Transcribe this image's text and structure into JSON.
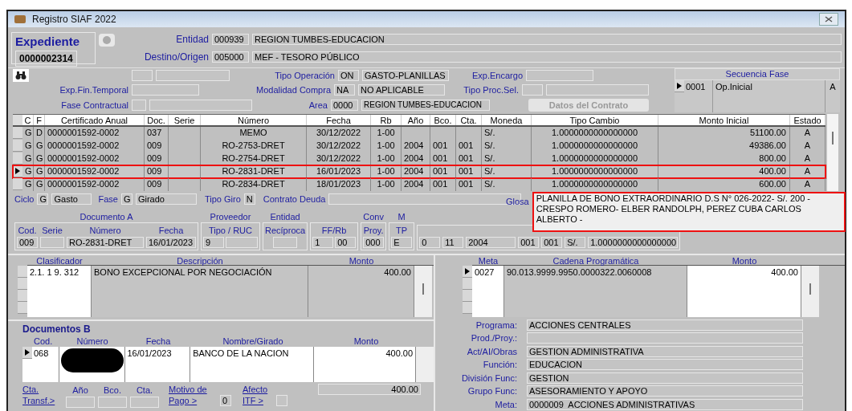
{
  "window": {
    "title": "Registro SIAF 2022"
  },
  "expediente": {
    "label": "Expediente",
    "number": "0000002314"
  },
  "entidad": {
    "label": "Entidad",
    "code": "000939",
    "name": "REGION TUMBES-EDUCACION"
  },
  "destino": {
    "label": "Destino/Origen",
    "code": "005000",
    "name": "MEF - TESORO PÚBLICO"
  },
  "left_fields": [
    {
      "label": "Exp.Fin.Temporal"
    },
    {
      "label": "Fase Contractual"
    }
  ],
  "mid_fields": [
    {
      "label": "Tipo Operación",
      "code": "ON",
      "name": "GASTO-PLANILLAS"
    },
    {
      "label": "Modalidad Compra",
      "code": "NA",
      "name": "NO APLICABLE"
    },
    {
      "label": "Area",
      "code": "0000",
      "name": "REGION TUMBES-EDUCACION"
    }
  ],
  "right_fields": [
    {
      "label": "Exp.Encargo"
    },
    {
      "label": "Tipo Proc.Sel."
    }
  ],
  "contract_button": {
    "label": "Datos del Contrato",
    "disabled": true
  },
  "secuencia_fase": {
    "title": "Secuencia Fase",
    "rows": [
      {
        "code": "0001",
        "name": "Op.Inicial",
        "estado": "A",
        "selected": true
      }
    ]
  },
  "registros": {
    "columns": [
      "C",
      "F",
      "Certificado Anual",
      "Doc.",
      "Serie",
      "Número",
      "Fecha",
      "Rb",
      "Año",
      "Bco.",
      "Cta.",
      "Moneda",
      "Tipo Cambio",
      "Monto Inicial",
      "Estado"
    ],
    "rows": [
      {
        "selected": false,
        "annotated": false,
        "cells": [
          "G",
          "D",
          "0000001592-0002",
          "037",
          null,
          "MEMO",
          "30/12/2022",
          "1-00",
          null,
          null,
          null,
          "S/.",
          "1.0000000000000000",
          "51100.00",
          "A"
        ]
      },
      {
        "selected": false,
        "annotated": false,
        "cells": [
          "G",
          "G",
          "0000001592-0002",
          "009",
          null,
          "RO-2753-DRET",
          "30/12/2022",
          "1-00",
          "2004",
          "001",
          "001",
          "S/.",
          "1.0000000000000000",
          "49386.00",
          "A"
        ]
      },
      {
        "selected": false,
        "annotated": false,
        "cells": [
          "G",
          "G",
          "0000001592-0002",
          "009",
          null,
          "RO-2754-DRET",
          "30/12/2022",
          "1-00",
          "2004",
          "001",
          "001",
          "S/.",
          "1.0000000000000000",
          "800.00",
          "A"
        ]
      },
      {
        "selected": true,
        "annotated": true,
        "cells": [
          "G",
          "G",
          "0000001592-0002",
          "009",
          null,
          "RO-2831-DRET",
          "16/01/2023",
          "1-00",
          "2004",
          "001",
          "001",
          "S/.",
          "1.0000000000000000",
          "400.00",
          "A"
        ]
      },
      {
        "selected": false,
        "annotated": false,
        "cells": [
          "G",
          "G",
          "0000001592-0002",
          "009",
          null,
          "RO-2834-DRET",
          "18/01/2023",
          "1-00",
          "2004",
          "001",
          "001",
          "S/.",
          "1.0000000000000000",
          "600.00",
          "A"
        ]
      }
    ]
  },
  "ciclo": {
    "label": "Ciclo",
    "code": "G",
    "name": "Gasto"
  },
  "fase": {
    "label": "Fase",
    "code": "G",
    "name": "Girado"
  },
  "tipo_giro": {
    "label": "Tipo Giro",
    "code": "N"
  },
  "contrato_deuda": {
    "label": "Contrato Deuda"
  },
  "glosa": {
    "label": "Glosa",
    "annotated": true,
    "text": "PLANILLA DE BONO EXTRAORDINARIO D.S N° 026-2022- S/. 200 - CRESPO ROMERO- ELBER RANDOLPH, PEREZ CUBA CARLOS ALBERTO -"
  },
  "documento_groups": [
    {
      "title": "Documento A",
      "fields": [
        {
          "label": "Cod.",
          "boxes": [
            {
              "value": "009"
            }
          ]
        },
        {
          "label": "Serie",
          "blank": true
        },
        {
          "label": "Número",
          "boxes": [
            {
              "value": "RO-2831-DRET"
            }
          ]
        },
        {
          "label": "Fecha",
          "boxes": [
            {
              "value": "16/01/2023"
            }
          ]
        }
      ]
    },
    {
      "title": "Proveedor",
      "fields": [
        {
          "label": "Tipo / RUC",
          "boxes": [
            {
              "value": "9"
            }
          ],
          "blank": true
        }
      ]
    },
    {
      "title": "Entidad",
      "fields": [
        {
          "label": "Recíproca",
          "blank": true
        }
      ]
    },
    {
      "fields": [
        {
          "label": "FF/Rb",
          "boxes": [
            {
              "value": "1"
            },
            {
              "value": "00"
            }
          ]
        }
      ]
    },
    {
      "title": "Conv",
      "fields": [
        {
          "label": "Proy.",
          "boxes": [
            {
              "value": "000"
            }
          ]
        }
      ]
    },
    {
      "title": "M",
      "fields": [
        {
          "label": "TP",
          "boxes": [
            {
              "value": "E"
            }
          ]
        }
      ]
    },
    {
      "fields": [
        {
          "boxes": [
            {
              "value": "0"
            }
          ]
        },
        {
          "boxes": [
            {
              "value": "11"
            }
          ]
        },
        {
          "boxes": [
            {
              "value": "2004"
            }
          ]
        },
        {
          "boxes": [
            {
              "value": "001"
            }
          ]
        },
        {
          "boxes": [
            {
              "value": "001"
            }
          ]
        },
        {
          "boxes": [
            {
              "value": "S/."
            }
          ]
        },
        {
          "boxes": [
            {
              "value": "1.0000000000000000"
            }
          ]
        }
      ]
    }
  ],
  "clasificador": {
    "columns": [
      "Clasificador",
      "Descripción",
      "Monto"
    ],
    "rows": [
      {
        "selected": false,
        "cells": [
          "2.1. 1 9. 312",
          "BONO EXCEPCIONAL POR NEGOCIACIÓN",
          "400.00"
        ]
      }
    ]
  },
  "metas": {
    "columns": [
      "Meta",
      "Cadena Programática",
      "Monto"
    ],
    "rows": [
      {
        "selected": true,
        "cells": [
          "0027",
          "90.013.9999.9950.0000322.0060008",
          "400.00"
        ]
      }
    ]
  },
  "documentos_b": {
    "title": "Documentos B",
    "columns": [
      "Cod.",
      "Número",
      "Fecha",
      "Nombre/Girado",
      "Monto"
    ],
    "rows": [
      {
        "selected": true,
        "redacted": true,
        "cells": [
          "068",
          null,
          "16/01/2023",
          "BANCO DE LA NACION",
          "400.00"
        ]
      }
    ],
    "total": "400.00"
  },
  "bottom_links": {
    "cta": "Cta. Transf.>",
    "labels": [
      "Año",
      "Bco.",
      "Cta."
    ],
    "motivo": "Motivo de Pago >",
    "motivo_value": "0",
    "afecto": "Afecto ITF >"
  },
  "programa": [
    {
      "label": "Programa:",
      "value": "ACCIONES CENTRALES"
    },
    {
      "label": "Prod./Proy.:"
    },
    {
      "label": "Act/AI/Obras",
      "value": "GESTION ADMINISTRATIVA"
    },
    {
      "label": "Función:",
      "value": "EDUCACION"
    },
    {
      "label": "División Func:",
      "value": "GESTION"
    },
    {
      "label": "Grupo Func:",
      "value": "ASESORAMIENTO Y APOYO"
    },
    {
      "label": "Meta:",
      "value": "0000009  ACCIONES ADMINISTRATIVAS"
    }
  ]
}
